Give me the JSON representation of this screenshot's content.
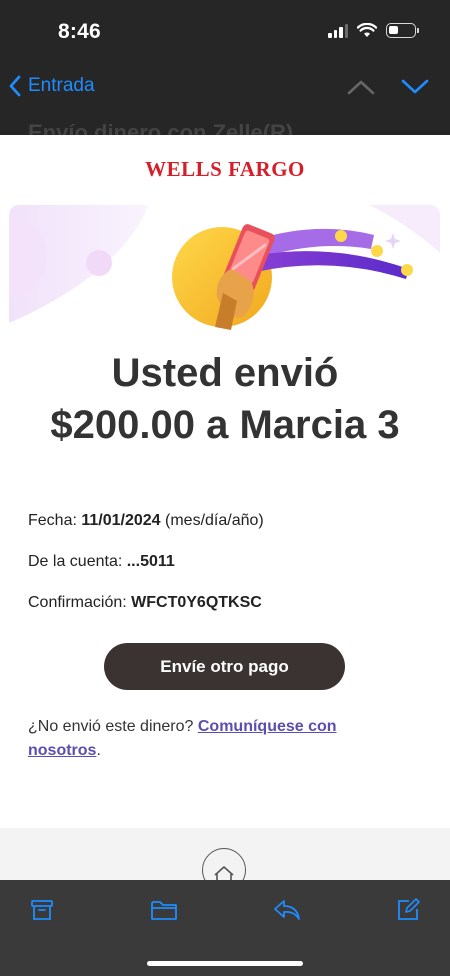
{
  "status_bar": {
    "time": "8:46"
  },
  "nav": {
    "back_label": "Entrada",
    "subject_partial": "Envío dinero con Zelle(R)"
  },
  "email": {
    "brand": "WELLS FARGO",
    "headline_line1": "Usted envió",
    "headline_line2": "$200.00 a Marcia 3",
    "details": {
      "date_label": "Fecha: ",
      "date_value": "11/01/2024",
      "date_format": " (mes/día/año)",
      "account_label": "De la cuenta: ",
      "account_value": "...5011",
      "confirmation_label": "Confirmación: ",
      "confirmation_value": "WFCT0Y6QTKSC"
    },
    "send_again_label": "Envíe otro pago",
    "help_text": "¿No envió este dinero? ",
    "help_link": "Comuníquese con nosotros",
    "help_end": "."
  },
  "toolbar_icons": [
    "archive-icon",
    "folder-icon",
    "reply-icon",
    "compose-icon"
  ],
  "colors": {
    "brand_red": "#d71e28",
    "ios_blue": "#1e8cff",
    "button_dark": "#3b3331",
    "link_purple": "#5a4fb0"
  }
}
